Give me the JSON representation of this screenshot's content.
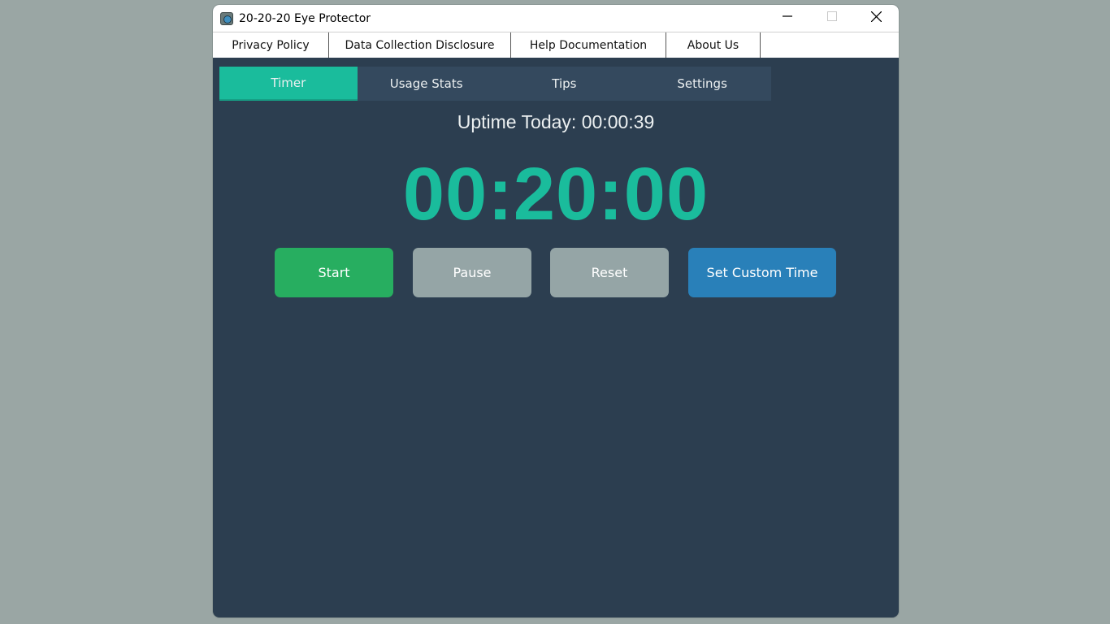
{
  "window": {
    "title": "20-20-20 Eye Protector",
    "controls": {
      "minimize": "—",
      "maximize": "☐",
      "close": "✕"
    }
  },
  "menu": {
    "items": [
      {
        "label": "Privacy Policy"
      },
      {
        "label": "Data Collection Disclosure"
      },
      {
        "label": "Help Documentation"
      },
      {
        "label": "About Us"
      }
    ]
  },
  "tabs": [
    {
      "label": "Timer",
      "active": true
    },
    {
      "label": "Usage Stats",
      "active": false
    },
    {
      "label": "Tips",
      "active": false
    },
    {
      "label": "Settings",
      "active": false
    }
  ],
  "timer_panel": {
    "uptime": "Uptime Today: 00:00:39",
    "countdown": "00:20:00",
    "buttons": {
      "start": "Start",
      "pause": "Pause",
      "reset": "Reset",
      "custom": "Set Custom Time"
    }
  },
  "colors": {
    "background": "#2c3e50",
    "accent": "#1abc9c",
    "start": "#27ae60",
    "neutral": "#95a5a6",
    "custom": "#2980b9"
  }
}
